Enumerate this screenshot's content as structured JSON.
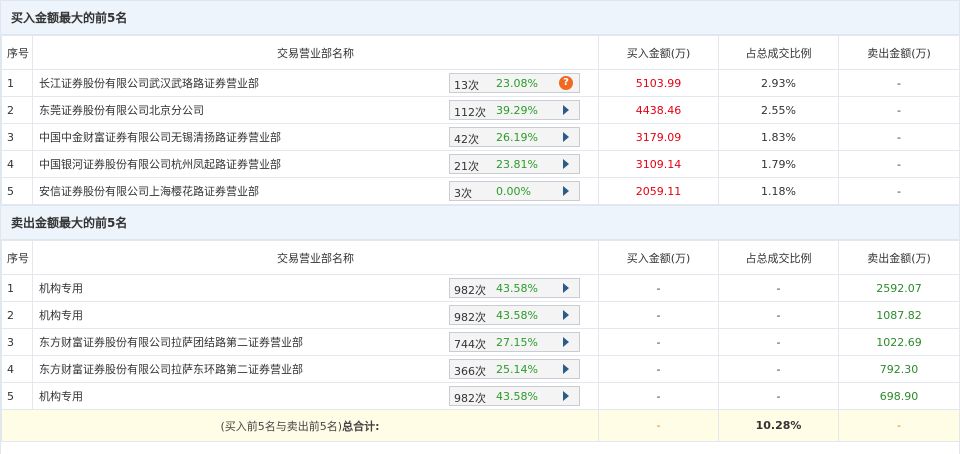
{
  "buy_section": {
    "title": "买入金额最大的前5名",
    "headers": {
      "idx": "序号",
      "name": "交易营业部名称",
      "buy": "买入金额(万)",
      "pct": "占总成交比例",
      "sell": "卖出金额(万)"
    },
    "rows": [
      {
        "idx": "1",
        "name": "长江证券股份有限公司武汉武珞路证券营业部",
        "count": "13次",
        "rate": "23.08%",
        "icon": "question-icon",
        "buy": "5103.99",
        "pct": "2.93%",
        "sell": "-"
      },
      {
        "idx": "2",
        "name": "东莞证券股份有限公司北京分公司",
        "count": "112次",
        "rate": "39.29%",
        "icon": "arrow-right-icon",
        "buy": "4438.46",
        "pct": "2.55%",
        "sell": "-"
      },
      {
        "idx": "3",
        "name": "中国中金财富证券有限公司无锡清扬路证券营业部",
        "count": "42次",
        "rate": "26.19%",
        "icon": "arrow-right-icon",
        "buy": "3179.09",
        "pct": "1.83%",
        "sell": "-"
      },
      {
        "idx": "4",
        "name": "中国银河证券股份有限公司杭州凤起路证券营业部",
        "count": "21次",
        "rate": "23.81%",
        "icon": "arrow-right-icon",
        "buy": "3109.14",
        "pct": "1.79%",
        "sell": "-"
      },
      {
        "idx": "5",
        "name": "安信证券股份有限公司上海樱花路证券营业部",
        "count": "3次",
        "rate": "0.00%",
        "icon": "arrow-right-icon",
        "buy": "2059.11",
        "pct": "1.18%",
        "sell": "-"
      }
    ]
  },
  "sell_section": {
    "title": "卖出金额最大的前5名",
    "headers": {
      "idx": "序号",
      "name": "交易营业部名称",
      "buy": "买入金额(万)",
      "pct": "占总成交比例",
      "sell": "卖出金额(万)"
    },
    "rows": [
      {
        "idx": "1",
        "name": "机构专用",
        "count": "982次",
        "rate": "43.58%",
        "icon": "arrow-right-icon",
        "buy": "-",
        "pct": "-",
        "sell": "2592.07"
      },
      {
        "idx": "2",
        "name": "机构专用",
        "count": "982次",
        "rate": "43.58%",
        "icon": "arrow-right-icon",
        "buy": "-",
        "pct": "-",
        "sell": "1087.82"
      },
      {
        "idx": "3",
        "name": "东方财富证券股份有限公司拉萨团结路第二证券营业部",
        "count": "744次",
        "rate": "27.15%",
        "icon": "arrow-right-icon",
        "buy": "-",
        "pct": "-",
        "sell": "1022.69"
      },
      {
        "idx": "4",
        "name": "东方财富证券股份有限公司拉萨东环路第二证券营业部",
        "count": "366次",
        "rate": "25.14%",
        "icon": "arrow-right-icon",
        "buy": "-",
        "pct": "-",
        "sell": "792.30"
      },
      {
        "idx": "5",
        "name": "机构专用",
        "count": "982次",
        "rate": "43.58%",
        "icon": "arrow-right-icon",
        "buy": "-",
        "pct": "-",
        "sell": "698.90"
      }
    ]
  },
  "total": {
    "label_prefix": "(买入前5名与卖出前5名)",
    "label_bold": "总合计:",
    "buy": "-",
    "pct": "10.28%",
    "sell": "-"
  },
  "colors": {
    "buy_value": "#e60012",
    "sell_value": "#2b8a2b",
    "rate": "#2b9b2b",
    "header_bg": "#eef4fb",
    "total_bg": "#fffde6"
  }
}
